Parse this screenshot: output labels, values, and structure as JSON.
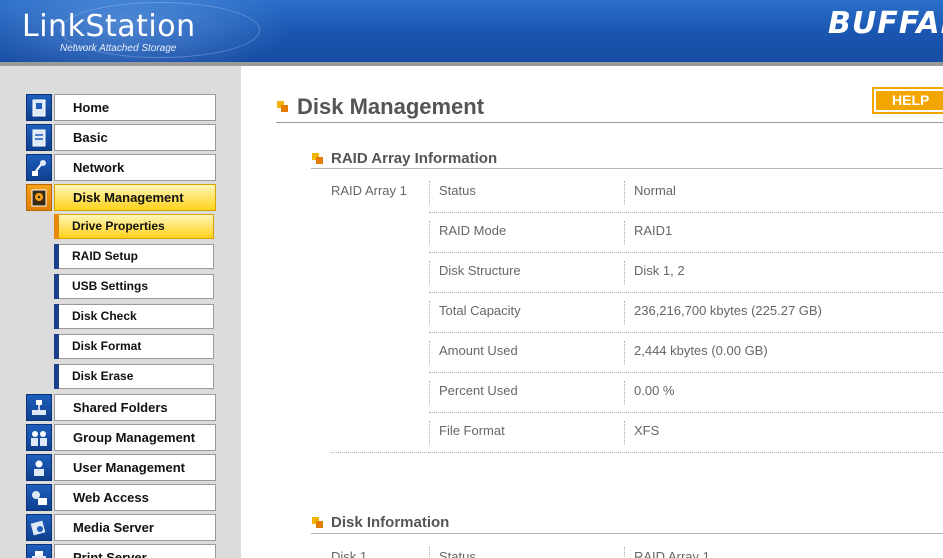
{
  "header": {
    "logo_title": "LinkStation",
    "logo_subtitle": "Network Attached Storage",
    "brand": "BUFFALO",
    "accent": "#1a55b0"
  },
  "sidebar": {
    "items": [
      {
        "label": "Home",
        "icon": "home-icon"
      },
      {
        "label": "Basic",
        "icon": "basic-settings-icon"
      },
      {
        "label": "Network",
        "icon": "network-icon"
      },
      {
        "label": "Disk Management",
        "icon": "disk-icon",
        "active": true
      },
      {
        "label": "Shared Folders",
        "icon": "shared-folders-icon"
      },
      {
        "label": "Group Management",
        "icon": "group-icon"
      },
      {
        "label": "User Management",
        "icon": "user-icon"
      },
      {
        "label": "Web Access",
        "icon": "web-access-icon"
      },
      {
        "label": "Media Server",
        "icon": "media-server-icon"
      },
      {
        "label": "Print Server",
        "icon": "print-server-icon"
      }
    ],
    "subitems": [
      {
        "label": "Drive Properties",
        "active": true
      },
      {
        "label": "RAID Setup"
      },
      {
        "label": "USB Settings"
      },
      {
        "label": "Disk Check"
      },
      {
        "label": "Disk Format"
      },
      {
        "label": "Disk Erase"
      }
    ],
    "active_color": "#ffd21a"
  },
  "main": {
    "page_title": "Disk Management",
    "help_label": "HELP",
    "raid_section": {
      "title": "RAID Array Information",
      "array_label": "RAID Array 1",
      "rows": [
        {
          "field": "Status",
          "value": "Normal"
        },
        {
          "field": "RAID Mode",
          "value": "RAID1"
        },
        {
          "field": "Disk Structure",
          "value": "Disk 1, 2"
        },
        {
          "field": "Total Capacity",
          "value": "236,216,700 kbytes (225.27 GB)"
        },
        {
          "field": "Amount Used",
          "value": "2,444 kbytes (0.00 GB)"
        },
        {
          "field": "Percent Used",
          "value": "0.00 %"
        },
        {
          "field": "File Format",
          "value": "XFS"
        }
      ]
    },
    "disk_section": {
      "title": "Disk Information",
      "disk_label": "Disk 1",
      "rows": [
        {
          "field": "Status",
          "value": "RAID Array 1"
        }
      ]
    }
  }
}
